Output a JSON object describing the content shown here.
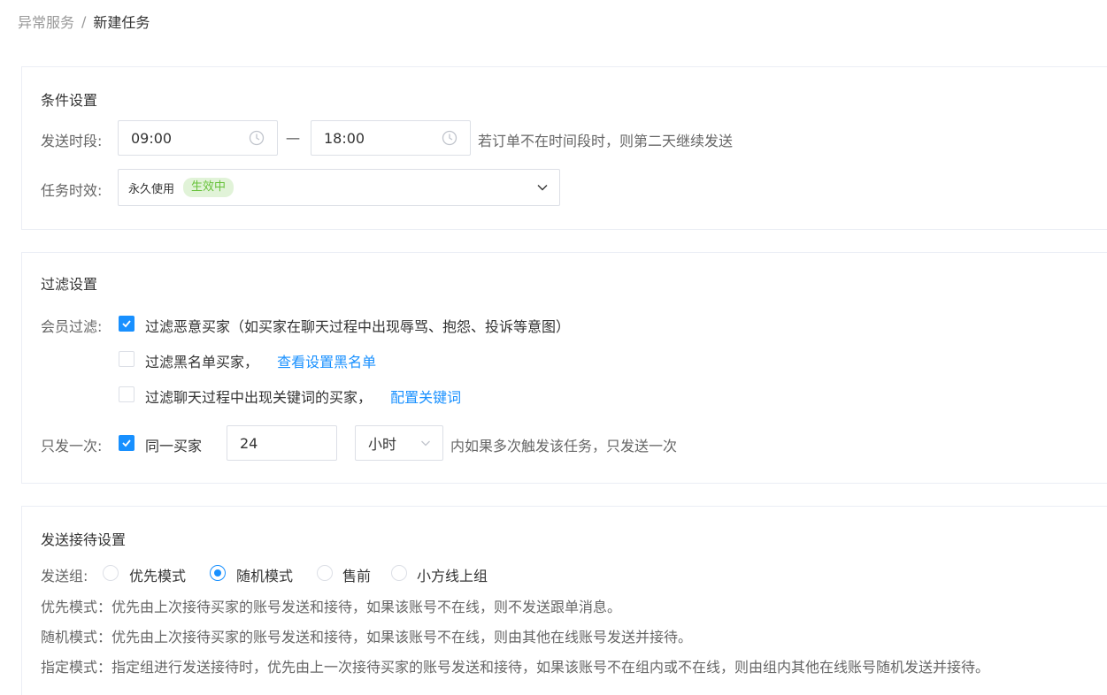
{
  "breadcrumb": {
    "parent": "异常服务",
    "separator": "/",
    "current": "新建任务"
  },
  "conditions": {
    "title": "条件设置",
    "send_period_label": "发送时段:",
    "start_time": "09:00",
    "dash": "一",
    "end_time": "18:00",
    "period_hint": "若订单不在时间段时，则第二天继续发送",
    "validity_label": "任务时效:",
    "validity_value": "永久使用",
    "validity_tag": "生效中"
  },
  "filters": {
    "title": "过滤设置",
    "member_filter_label": "会员过滤:",
    "options": [
      {
        "label": "过滤恶意买家（如买家在聊天过程中出现辱骂、抱怨、投诉等意图）",
        "checked": true,
        "link": ""
      },
      {
        "label": "过滤黑名单买家，",
        "checked": false,
        "link": "查看设置黑名单"
      },
      {
        "label": "过滤聊天过程中出现关键词的买家，",
        "checked": false,
        "link": "配置关键词"
      }
    ],
    "once_label": "只发一次:",
    "same_buyer_label": "同一买家",
    "same_buyer_checked": true,
    "hours_value": "24",
    "unit_value": "小时",
    "once_hint": "内如果多次触发该任务，只发送一次"
  },
  "dispatch": {
    "title": "发送接待设置",
    "group_label": "发送组:",
    "groups": [
      {
        "label": "优先模式",
        "checked": false
      },
      {
        "label": "随机模式",
        "checked": true
      },
      {
        "label": "售前",
        "checked": false
      },
      {
        "label": "小方线上组",
        "checked": false
      }
    ],
    "descriptions": [
      "优先模式：优先由上次接待买家的账号发送和接待，如果该账号不在线，则不发送跟单消息。",
      "随机模式：优先由上次接待买家的账号发送和接待，如果该账号不在线，则由其他在线账号发送并接待。",
      "指定模式：指定组进行发送接待时，优先由上一次接待买家的账号发送和接待，如果该账号不在组内或不在线，则由组内其他在线账号随机发送并接待。"
    ]
  },
  "colors": {
    "primary": "#1890ff",
    "success_tag_bg": "#e1f3d8",
    "success_tag_text": "#67c23a"
  }
}
